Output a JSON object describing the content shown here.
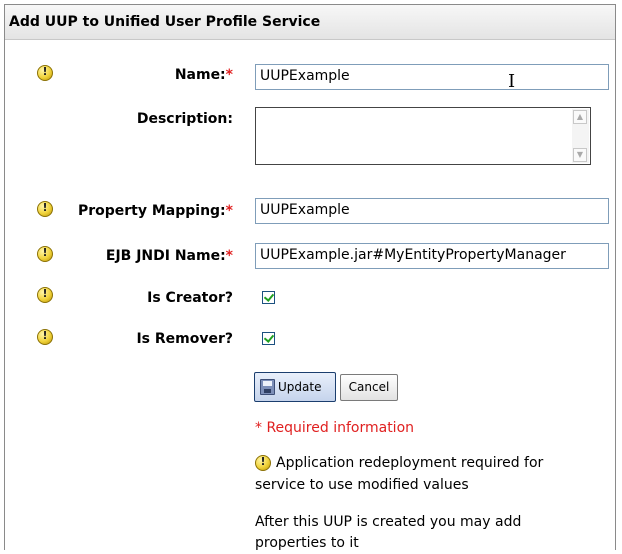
{
  "panel": {
    "title": "Add UUP to Unified User Profile Service"
  },
  "form": {
    "name": {
      "label": "Name:",
      "required_mark": "*",
      "value": "UUPExample"
    },
    "description": {
      "label": "Description:",
      "value": ""
    },
    "property_mapping": {
      "label": "Property Mapping:",
      "required_mark": "*",
      "value": "UUPExample"
    },
    "ejb_jndi_name": {
      "label": "EJB JNDI Name:",
      "required_mark": "*",
      "value": "UUPExample.jar#MyEntityPropertyManager"
    },
    "is_creator": {
      "label": "Is Creator?",
      "checked": true
    },
    "is_remover": {
      "label": "Is Remover?",
      "checked": true
    }
  },
  "buttons": {
    "update": "Update",
    "cancel": "Cancel"
  },
  "notes": {
    "required": "* Required information",
    "redeploy_line1": "Application redeployment required for",
    "redeploy_line2": "service to use modified values",
    "after_line1": "After this UUP is created you may add",
    "after_line2": "properties to it"
  },
  "icons": {
    "warning": "warning-icon",
    "save": "save-icon",
    "text_cursor": "text-cursor-icon"
  },
  "colors": {
    "required": "#e02020",
    "warning": "#f0d23a",
    "check": "#21a121"
  }
}
